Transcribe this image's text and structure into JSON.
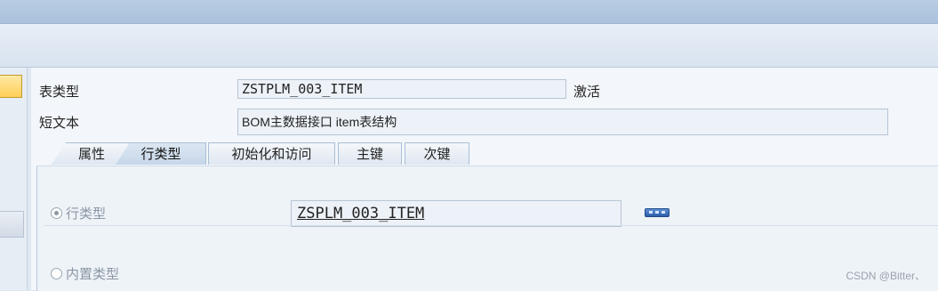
{
  "form": {
    "table_type_label": "表类型",
    "table_type_value": "ZSTPLM_003_ITEM",
    "status": "激活",
    "short_text_label": "短文本",
    "short_text_value": "BOM主数据接口 item表结构"
  },
  "tabs": [
    {
      "label": "属性"
    },
    {
      "label": "行类型",
      "active": true
    },
    {
      "label": "初始化和访问"
    },
    {
      "label": "主键"
    },
    {
      "label": "次键"
    }
  ],
  "row_type": {
    "option_row_type": "行类型",
    "value": "ZSPLM_003_ITEM",
    "option_builtin": "内置类型"
  },
  "watermark": "CSDN @Bitter、",
  "colors": {
    "accent": "#2d5fab",
    "bg": "#dfe8f2"
  }
}
